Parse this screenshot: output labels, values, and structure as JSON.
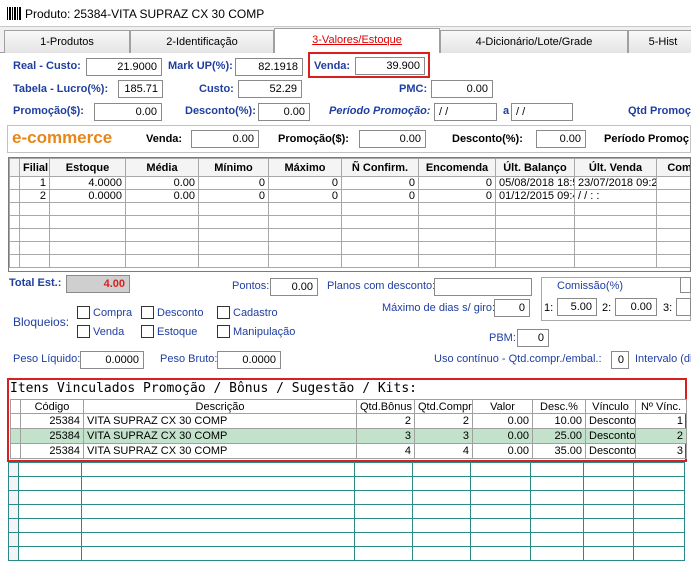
{
  "window": {
    "title": "Produto: 25384-VITA SUPRAZ CX 30 COMP"
  },
  "tabs": [
    "1-Produtos",
    "2-Identificação",
    "3-Valores/Estoque",
    "4-Dicionário/Lote/Grade",
    "5-Hist"
  ],
  "prices": {
    "real_custo_label": "Real - Custo:",
    "real_custo": "21.9000",
    "markup_label": "Mark UP(%):",
    "markup": "82.1918",
    "venda_label": "Venda:",
    "venda": "39.900",
    "tabela_lucro_label": "Tabela - Lucro(%):",
    "tabela_lucro": "185.71",
    "custo_label": "Custo:",
    "custo": "52.29",
    "pmc_label": "PMC:",
    "pmc": "0.00",
    "promocao_label": "Promoção($):",
    "promocao": "0.00",
    "desconto_label": "Desconto(%):",
    "desconto": "0.00",
    "periodo_label": "Período Promoção:",
    "periodo_de": " /  /",
    "periodo_a_label": "a",
    "periodo_ate": " /  /",
    "qtd_promo_label": "Qtd Promoç"
  },
  "ecommerce": {
    "title": "e-commerce",
    "venda_label": "Venda:",
    "venda": "0.00",
    "promocao_label": "Promoção($):",
    "promocao": "0.00",
    "desconto_label": "Desconto(%):",
    "desconto": "0.00",
    "periodo_label": "Período Promoç"
  },
  "stock": {
    "columns": [
      "Filial",
      "Estoque",
      "Média",
      "Mínimo",
      "Máximo",
      "Ñ Confirm.",
      "Encomenda",
      "Últ. Balanço",
      "Últ. Venda",
      "Comis. G"
    ],
    "rows": [
      [
        "1",
        "4.0000",
        "0.00",
        "0",
        "0",
        "0",
        "0",
        "05/08/2018 18:5",
        "23/07/2018 09:2",
        ""
      ],
      [
        "2",
        "0.0000",
        "0.00",
        "0",
        "0",
        "0",
        "0",
        "01/12/2015 09:4",
        "/  /     :  :",
        ""
      ]
    ]
  },
  "totals": {
    "total_est_label": "Total Est.:",
    "total_est": "4.00",
    "pontos_label": "Pontos:",
    "pontos": "0.00",
    "planos_label": "Planos com desconto:",
    "planos": "",
    "comissao_label": "Comissão(%)",
    "max_dias_label": "Máximo de dias s/ giro:",
    "max_dias": "0",
    "com1_label": "1:",
    "com1": "5.00",
    "com2_label": "2:",
    "com2": "0.00",
    "com3_label": "3:",
    "pbm_label": "PBM:",
    "pbm": "0",
    "peso_liq_label": "Peso Líquido:",
    "peso_liq": "0.0000",
    "peso_bruto_label": "Peso Bruto:",
    "peso_bruto": "0.0000",
    "uso_label": "Uso contínuo - Qtd.compr./embal.:",
    "uso": "0",
    "intervalo_label": "Intervalo (di"
  },
  "bloqueios": {
    "label": "Bloqueios:",
    "options": [
      "Compra",
      "Desconto",
      "Cadastro",
      "Venda",
      "Estoque",
      "Manipulação"
    ]
  },
  "vinculados": {
    "title": "Itens Vinculados Promoção / Bônus / Sugestão / Kits:",
    "columns": [
      "Código",
      "Descrição",
      "Qtd.Bônus",
      "Qtd.Compra",
      "Valor",
      "Desc.%",
      "Vínculo",
      "Nº Vínc."
    ],
    "rows": [
      [
        "25384",
        "VITA SUPRAZ CX 30 COMP",
        "2",
        "2",
        "0.00",
        "10.00",
        "Desconto",
        "1"
      ],
      [
        "25384",
        "VITA SUPRAZ CX 30 COMP",
        "3",
        "3",
        "0.00",
        "25.00",
        "Desconto",
        "2"
      ],
      [
        "25384",
        "VITA SUPRAZ CX 30 COMP",
        "4",
        "4",
        "0.00",
        "35.00",
        "Desconto",
        "3"
      ]
    ]
  },
  "colors": {
    "label_blue": "#1f3ea0",
    "highlight_red": "#d92020",
    "ecommerce_orange": "#e8861a",
    "selected_row": "#c3e2cc",
    "grid_teal": "#2a8a8a"
  }
}
